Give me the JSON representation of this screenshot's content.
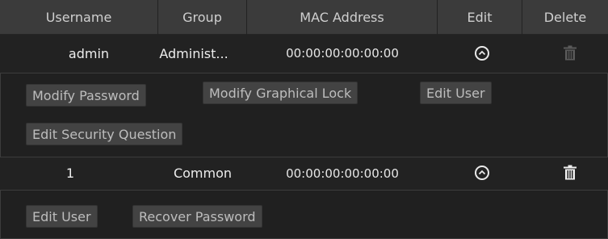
{
  "columns": {
    "username": "Username",
    "group": "Group",
    "mac": "MAC Address",
    "edit": "Edit",
    "delete": "Delete"
  },
  "users": [
    {
      "username": "admin",
      "group": "Administ...",
      "mac": "00:00:00:00:00:00",
      "delete_enabled": false,
      "actions": [
        "Modify Password",
        "Modify Graphical Lock",
        "Edit User",
        "Edit Security Question"
      ]
    },
    {
      "username": "1",
      "group": "Common",
      "mac": "00:00:00:00:00:00",
      "delete_enabled": true,
      "actions": [
        "Edit User",
        "Recover Password"
      ]
    }
  ],
  "icons": {
    "edit": "collapse-chevron-up-icon",
    "delete": "trash-icon"
  },
  "colors": {
    "header_bg": "#3b3b3b",
    "row_bg": "#222222",
    "panel_bg": "#202020",
    "button_bg": "#434343",
    "disabled_icon": "#5a5a5a",
    "enabled_icon": "#efefef"
  }
}
